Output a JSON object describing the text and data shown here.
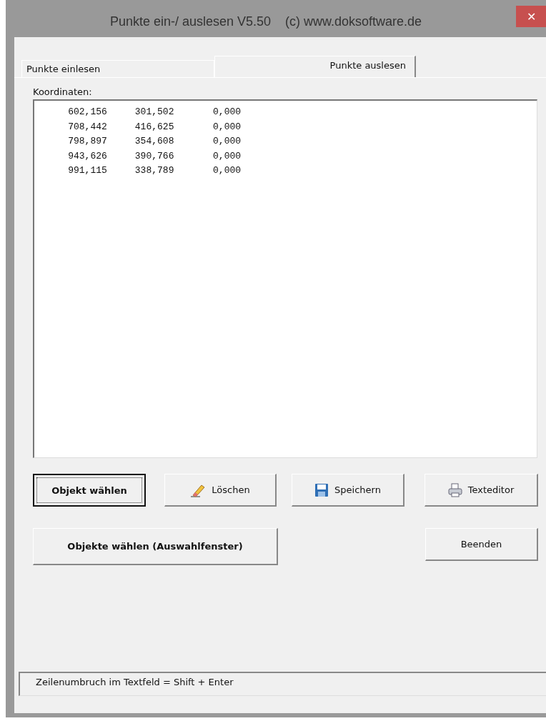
{
  "window": {
    "title": "Punkte ein-/ auslesen V5.50    (c) www.doksoftware.de",
    "close": "✕"
  },
  "tabs": [
    {
      "label": "Punkte einlesen",
      "selected": false
    },
    {
      "label": "Punkte auslesen",
      "selected": true
    }
  ],
  "coordinates": {
    "label": "Koordinaten:",
    "lines": [
      "    602,156     301,502       0,000",
      "    708,442     416,625       0,000",
      "    798,897     354,608       0,000",
      "    943,626     390,766       0,000",
      "    991,115     338,789       0,000"
    ]
  },
  "buttons": [
    {
      "label": "Objekt wählen",
      "bold": true,
      "default": true,
      "kind": "plain"
    },
    {
      "label": "Löschen",
      "bold": false,
      "default": false,
      "kind": "eraser"
    },
    {
      "label": "Speichern",
      "bold": false,
      "default": false,
      "kind": "floppy"
    },
    {
      "label": "Texteditor",
      "bold": false,
      "default": false,
      "kind": "printer"
    },
    {
      "label": "Objekte wählen (Auswahlfenster)",
      "bold": true,
      "default": false
    },
    {
      "label": "Beenden",
      "bold": false,
      "default": false
    }
  ],
  "status_bar": "Zeilenumbruch im Textfeld = Shift + Enter"
}
